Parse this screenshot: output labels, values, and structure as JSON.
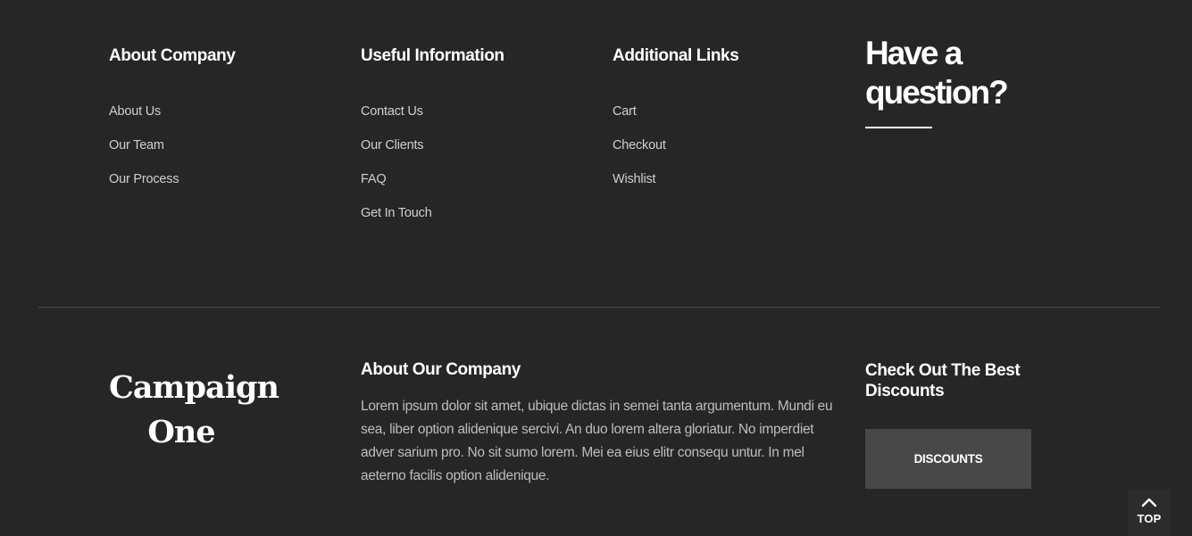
{
  "footer_top": {
    "columns": [
      {
        "heading": "About Company",
        "links": [
          "About Us",
          "Our Team",
          "Our Process"
        ]
      },
      {
        "heading": "Useful Information",
        "links": [
          "Contact Us",
          "Our Clients",
          "FAQ",
          "Get In Touch"
        ]
      },
      {
        "heading": "Additional Links",
        "links": [
          "Cart",
          "Checkout",
          "Wishlist"
        ]
      }
    ],
    "question_title": "Have a question?"
  },
  "footer_bottom": {
    "logo": "Campaign One",
    "about_heading": "About Our Company",
    "about_text": "Lorem ipsum dolor sit amet, ubique dictas in semei tanta argumentum. Mundi eu sea, liber option alidenique sercivi. An duo lorem altera gloriatur. No imperdiet adver sarium pro. No sit sumo lorem. Mei ea eius elitr consequ untur. In mel aeterno facilis option alidenique.",
    "discount_heading": "Check Out The Best Discounts",
    "discount_button": "DISCOUNTS"
  },
  "back_to_top": {
    "label": "TOP",
    "icon": "chevron-up-icon"
  },
  "colors": {
    "background": "#262626",
    "button_bg": "#484848",
    "divider": "#474747"
  }
}
